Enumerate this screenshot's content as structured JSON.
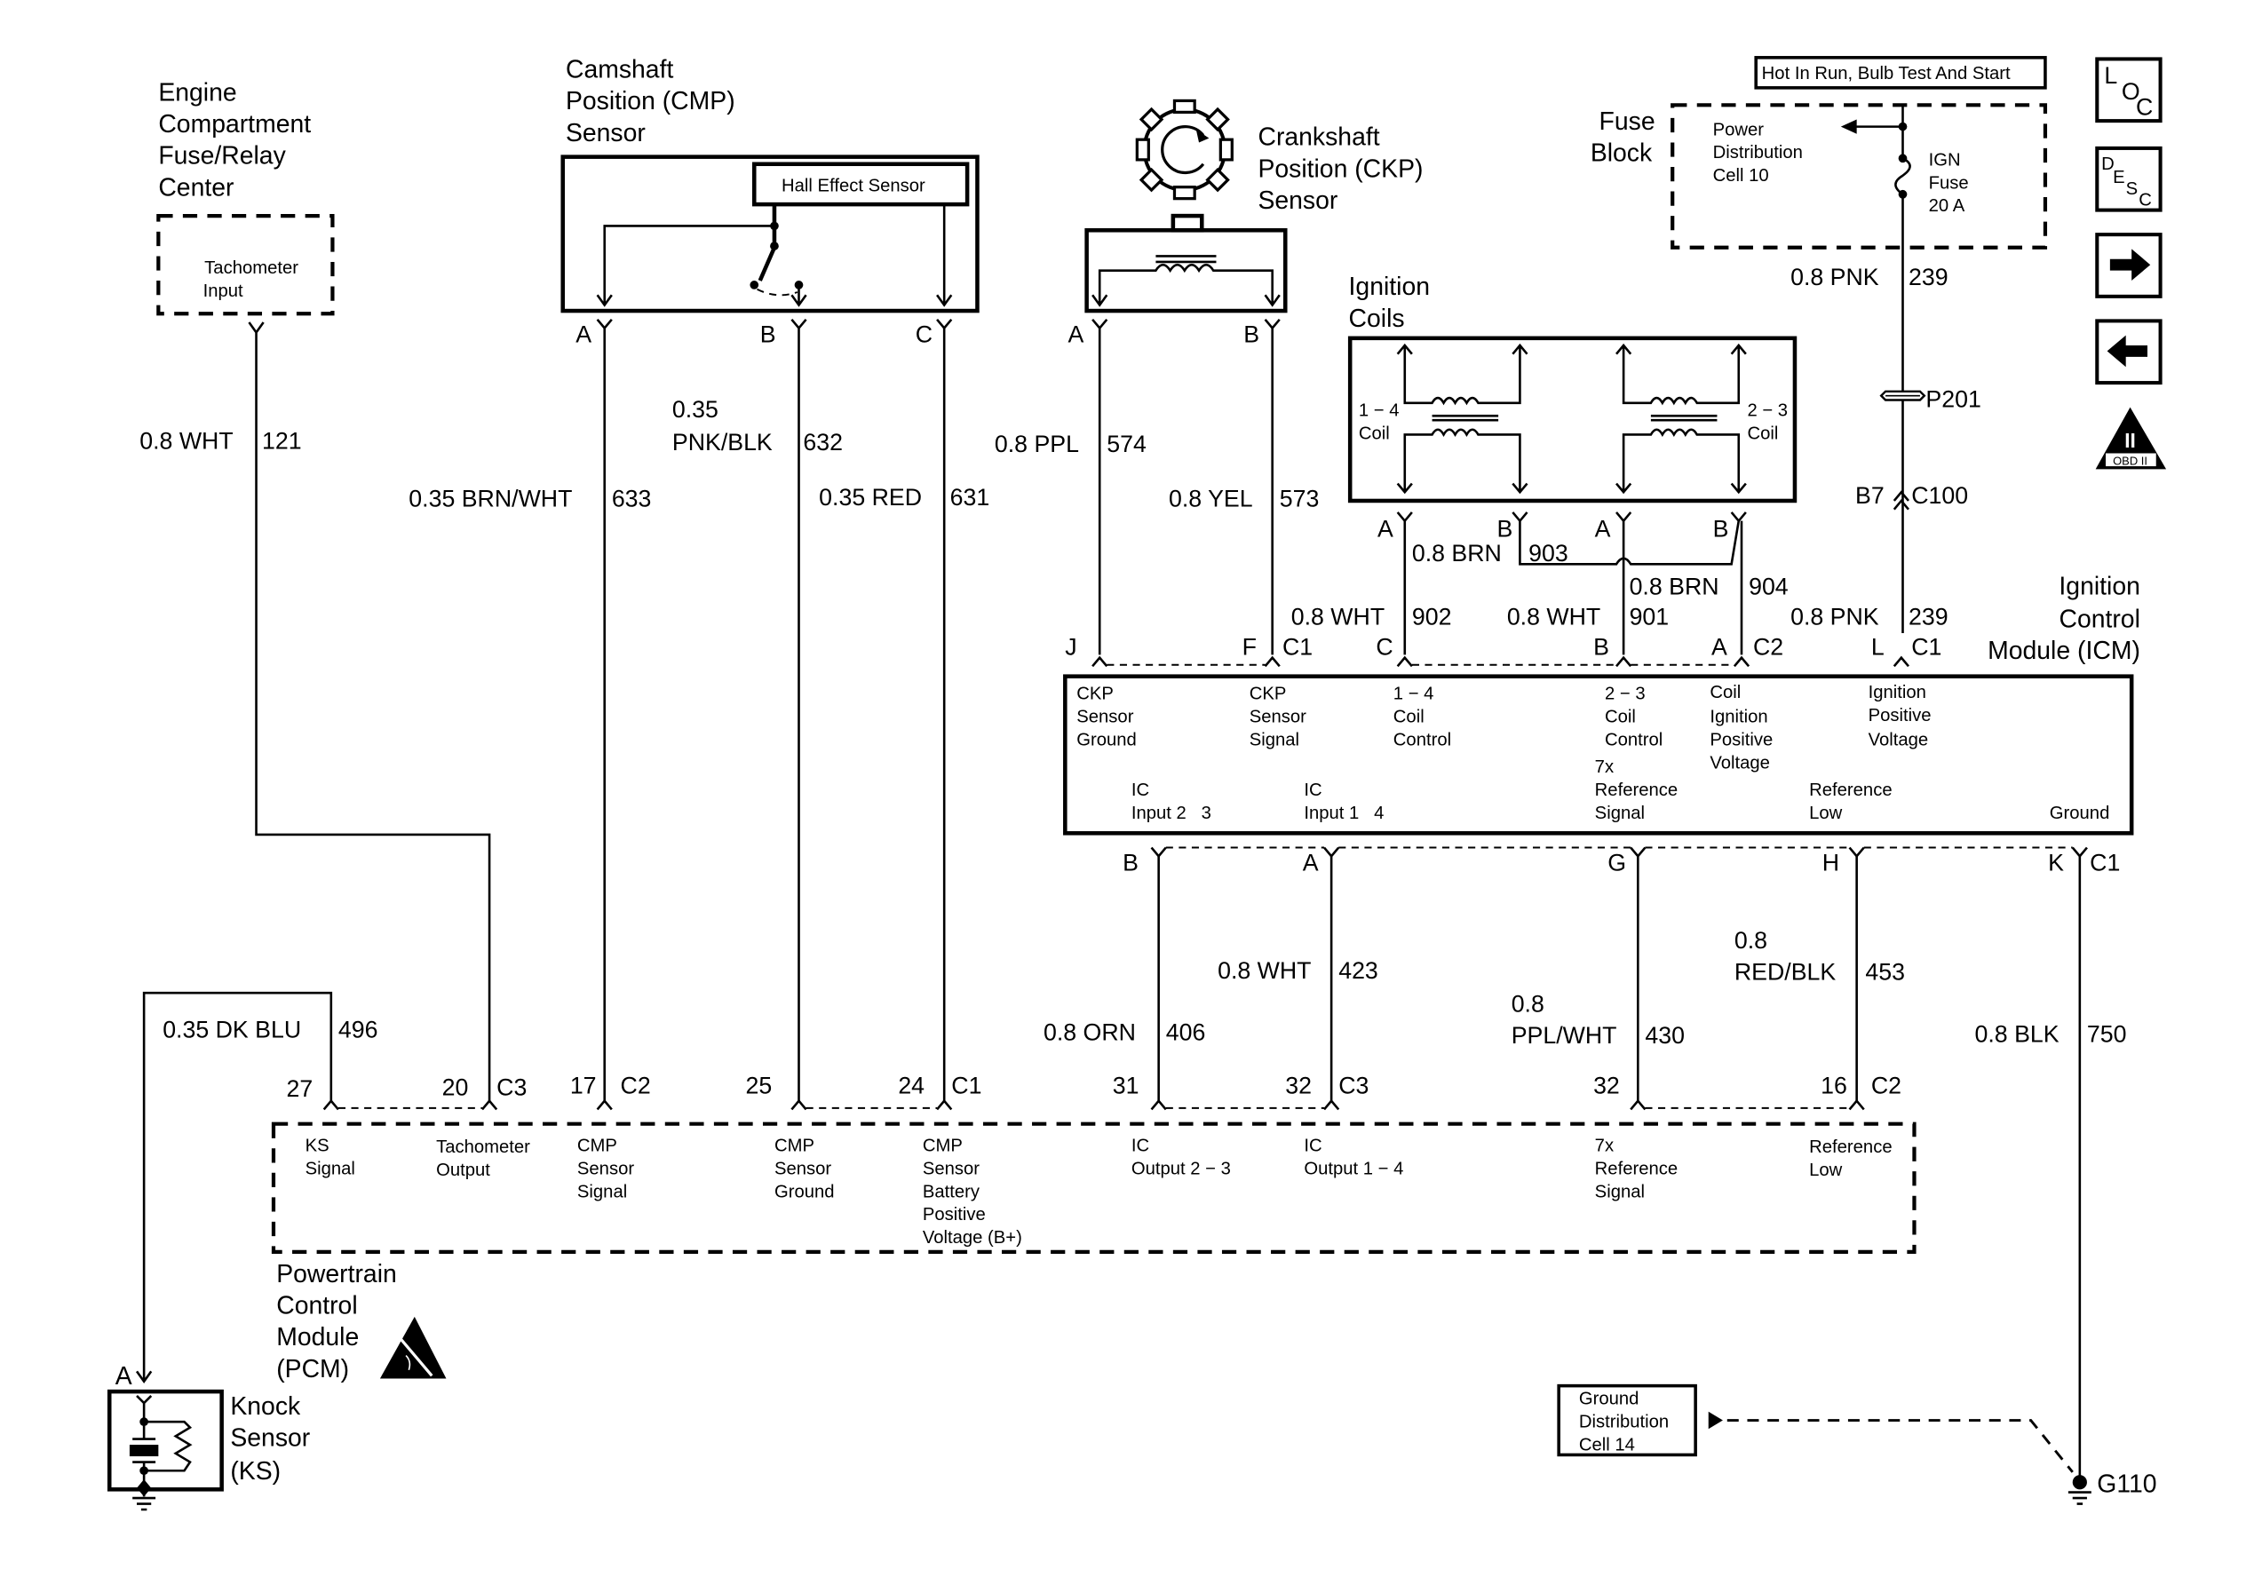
{
  "components": {
    "engine_fuse_center": {
      "title": [
        "Engine",
        "Compartment",
        "Fuse/Relay",
        "Center"
      ],
      "inner": [
        "Tachometer",
        "Input"
      ]
    },
    "cmp_sensor": {
      "title": [
        "Camshaft",
        "Position (CMP)",
        "Sensor"
      ],
      "inner": "Hall Effect Sensor",
      "pins": [
        "A",
        "B",
        "C"
      ]
    },
    "ckp_sensor": {
      "title": [
        "Crankshaft",
        "Position (CKP)",
        "Sensor"
      ],
      "pins": [
        "A",
        "B"
      ]
    },
    "fuse_block": {
      "title": [
        "Fuse",
        "Block"
      ],
      "cell": [
        "Power",
        "Distribution",
        "Cell 10"
      ],
      "fuse": [
        "IGN",
        "Fuse",
        "20 A"
      ],
      "hot_label": "Hot In Run, Bulb Test And Start"
    },
    "ignition_coils": {
      "title": [
        "Ignition",
        "Coils"
      ],
      "coil_a": [
        "1 − 4",
        "Coil"
      ],
      "coil_b": [
        "2 − 3",
        "Coil"
      ],
      "pins": [
        "A",
        "B",
        "A",
        "B"
      ]
    },
    "icm": {
      "title": [
        "Ignition",
        "Control",
        "Module (ICM)"
      ],
      "top_pins": [
        {
          "pin": "J",
          "label": [
            "CKP",
            "Sensor",
            "Ground"
          ]
        },
        {
          "pin": "F",
          "conn": "C1",
          "label": [
            "CKP",
            "Sensor",
            "Signal"
          ]
        },
        {
          "pin": "C",
          "label": [
            "1 − 4",
            "Coil",
            "Control"
          ]
        },
        {
          "pin": "B",
          "label": [
            "2 − 3",
            "Coil",
            "Control"
          ]
        },
        {
          "pin": "A",
          "conn": "C2",
          "label": [
            "Coil",
            "Ignition",
            "Positive",
            "Voltage"
          ]
        },
        {
          "pin": "L",
          "conn": "C1",
          "label": [
            "Ignition",
            "Positive",
            "Voltage"
          ]
        }
      ],
      "bottom_pins": [
        {
          "pin": "B",
          "label": [
            "IC",
            "Input 2   3"
          ]
        },
        {
          "pin": "A",
          "label": [
            "IC",
            "Input 1   4"
          ]
        },
        {
          "pin": "G",
          "label": [
            "7x",
            "Reference",
            "Signal"
          ]
        },
        {
          "pin": "H",
          "label": [
            "Reference",
            "Low"
          ]
        },
        {
          "pin": "K",
          "conn": "C1",
          "label": [
            "Ground"
          ]
        }
      ]
    },
    "pcm": {
      "title": [
        "Powertrain",
        "Control",
        "Module",
        "(PCM)"
      ],
      "pins": [
        {
          "pin": "27",
          "label": [
            "KS",
            "Signal"
          ]
        },
        {
          "pin": "20",
          "conn": "C3",
          "label": [
            "Tachometer",
            "Output"
          ]
        },
        {
          "pin": "17",
          "conn": "C2",
          "label": [
            "CMP",
            "Sensor",
            "Signal"
          ]
        },
        {
          "pin": "25",
          "label": [
            "CMP",
            "Sensor",
            "Ground"
          ]
        },
        {
          "pin": "24",
          "conn": "C1",
          "label": [
            "CMP",
            "Sensor",
            "Battery",
            "Positive",
            "Voltage (B+)"
          ]
        },
        {
          "pin": "31",
          "label": [
            "IC",
            "Output 2 − 3"
          ]
        },
        {
          "pin": "32",
          "conn": "C3",
          "label": [
            "IC",
            "Output 1 − 4"
          ]
        },
        {
          "pin": "32",
          "label": [
            "7x",
            "Reference",
            "Signal"
          ]
        },
        {
          "pin": "16",
          "conn": "C2",
          "label": [
            "Reference",
            "Low"
          ]
        }
      ]
    },
    "knock_sensor": {
      "title": [
        "Knock",
        "Sensor",
        "(KS)"
      ],
      "pin": "A"
    },
    "ground_dist": {
      "label": [
        "Ground",
        "Distribution",
        "Cell 14"
      ],
      "ground": "G110"
    }
  },
  "wires": {
    "w121": {
      "gauge_color": "0.8 WHT",
      "circuit": "121"
    },
    "w633": {
      "gauge_color": "0.35 BRN/WHT",
      "circuit": "633"
    },
    "w632": {
      "gauge_color": [
        "0.35",
        "PNK/BLK"
      ],
      "circuit": "632"
    },
    "w631": {
      "gauge_color": "0.35 RED",
      "circuit": "631"
    },
    "w574": {
      "gauge_color": "0.8 PPL",
      "circuit": "574"
    },
    "w573": {
      "gauge_color": "0.8 YEL",
      "circuit": "573"
    },
    "w903": {
      "gauge_color": "0.8 BRN",
      "circuit": "903"
    },
    "w904": {
      "gauge_color": "0.8 BRN",
      "circuit": "904"
    },
    "w902": {
      "gauge_color": "0.8 WHT",
      "circuit": "902"
    },
    "w901": {
      "gauge_color": "0.8 WHT",
      "circuit": "901"
    },
    "w239a": {
      "gauge_color": "0.8 PNK",
      "circuit": "239"
    },
    "w239b": {
      "gauge_color": "0.8 PNK",
      "circuit": "239"
    },
    "w496": {
      "gauge_color": "0.35 DK BLU",
      "circuit": "496"
    },
    "w406": {
      "gauge_color": "0.8 ORN",
      "circuit": "406"
    },
    "w423": {
      "gauge_color": "0.8 WHT",
      "circuit": "423"
    },
    "w430": {
      "gauge_color": [
        "0.8",
        "PPL/WHT"
      ],
      "circuit": "430"
    },
    "w453": {
      "gauge_color": [
        "0.8",
        "RED/BLK"
      ],
      "circuit": "453"
    },
    "w750": {
      "gauge_color": "0.8 BLK",
      "circuit": "750"
    }
  },
  "connectors": {
    "splice": "P201",
    "inline_pin": "B7",
    "inline": "C100"
  },
  "nav_icons": [
    {
      "name": "loc-icon",
      "letters": [
        "L",
        "O",
        "C"
      ]
    },
    {
      "name": "desc-icon",
      "letters": [
        "D",
        "E",
        "S",
        "C"
      ]
    },
    {
      "name": "next-arrow-icon"
    },
    {
      "name": "prev-arrow-icon"
    },
    {
      "name": "obd-ii-icon",
      "label": "OBD II",
      "numeral": "II"
    }
  ]
}
